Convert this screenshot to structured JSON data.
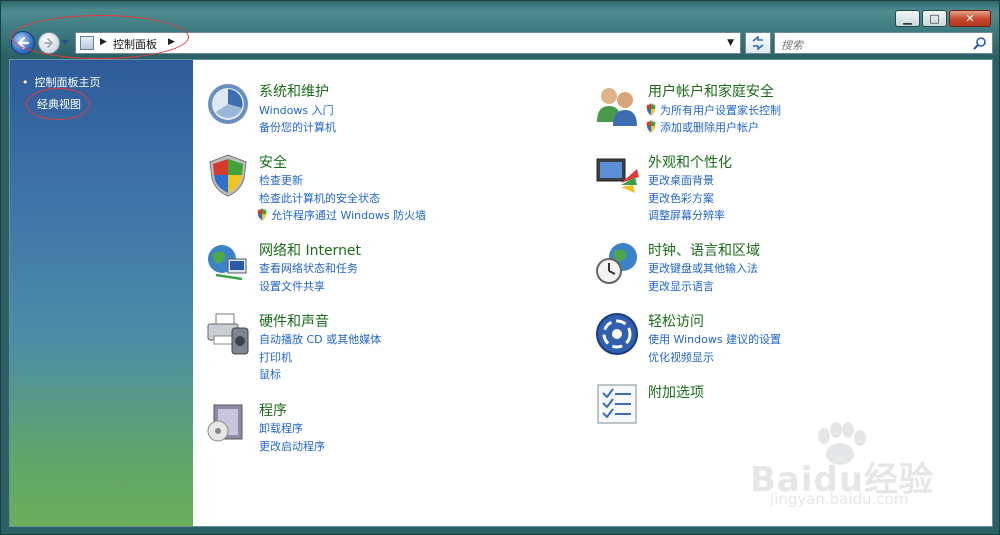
{
  "window": {
    "minimize": "▁",
    "maximize": "□",
    "close": "✕"
  },
  "address": {
    "crumb": "控制面板",
    "sep": "▶",
    "dropdown": "▼"
  },
  "search": {
    "placeholder": "搜索"
  },
  "sidebar": {
    "home": "控制面板主页",
    "classic": "经典视图"
  },
  "categories": {
    "system": {
      "title": "系统和维护",
      "links": [
        "Windows 入门",
        "备份您的计算机"
      ]
    },
    "security": {
      "title": "安全",
      "links": [
        "检查更新",
        "检查此计算机的安全状态",
        "允许程序通过 Windows 防火墙"
      ]
    },
    "network": {
      "title": "网络和 Internet",
      "links": [
        "查看网络状态和任务",
        "设置文件共享"
      ]
    },
    "hardware": {
      "title": "硬件和声音",
      "links": [
        "自动播放 CD 或其他媒体",
        "打印机",
        "鼠标"
      ]
    },
    "programs": {
      "title": "程序",
      "links": [
        "卸载程序",
        "更改启动程序"
      ]
    },
    "users": {
      "title": "用户帐户和家庭安全",
      "links": [
        "为所有用户设置家长控制",
        "添加或删除用户帐户"
      ]
    },
    "appearance": {
      "title": "外观和个性化",
      "links": [
        "更改桌面背景",
        "更改色彩方案",
        "调整屏幕分辨率"
      ]
    },
    "clock": {
      "title": "时钟、语言和区域",
      "links": [
        "更改键盘或其他输入法",
        "更改显示语言"
      ]
    },
    "ease": {
      "title": "轻松访问",
      "links": [
        "使用 Windows 建议的设置",
        "优化视频显示"
      ]
    },
    "addons": {
      "title": "附加选项"
    }
  },
  "watermark": {
    "text": "Baidu经验",
    "url": "jingyan.baidu.com"
  },
  "colors": {
    "link": "#2266cc",
    "category_title": "#1a6d1a",
    "annotation": "#e03a3a"
  }
}
